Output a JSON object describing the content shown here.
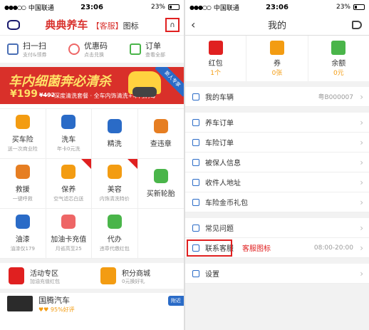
{
  "left": {
    "status": {
      "carrier": "中国联通",
      "time": "23:06",
      "battery": "23%"
    },
    "header": {
      "title": "典典养车",
      "note_bracket": "【客服】",
      "note_text": "图标"
    },
    "shortcuts": [
      {
        "label": "扫一扫",
        "sub": "支付&领券"
      },
      {
        "label": "优惠码",
        "sub": "点击兑换"
      },
      {
        "label": "订单",
        "sub": "查看全部"
      }
    ],
    "banner": {
      "slogan": "车内细菌奔必清杀",
      "price": "¥199",
      "old_price": "¥492",
      "sub": "深度清洗套餐 · 全车内饰清洗+车内消毒",
      "ribbon": "新人专享"
    },
    "grid": [
      {
        "label": "买车险",
        "sub": "送一次商业险",
        "color": "#f39c12",
        "tag": false
      },
      {
        "label": "洗车",
        "sub": "年卡0元洗",
        "color": "#2a6bc7",
        "tag": false
      },
      {
        "label": "精洗",
        "sub": "",
        "color": "#2a6bc7",
        "tag": false
      },
      {
        "label": "查违章",
        "sub": "",
        "color": "#e67e22",
        "tag": false
      },
      {
        "label": "救援",
        "sub": "一键呼救",
        "color": "#e67e22",
        "tag": false
      },
      {
        "label": "保养",
        "sub": "空气滤芯白送",
        "color": "#f39c12",
        "tag": true
      },
      {
        "label": "美容",
        "sub": "内饰清洗特价",
        "color": "#f39c12",
        "tag": true
      },
      {
        "label": "买新轮胎",
        "sub": "",
        "color": "#4ab54a",
        "tag": false
      },
      {
        "label": "油漆",
        "sub": "油漆仅179",
        "color": "#2a6bc7",
        "tag": false
      },
      {
        "label": "加油卡充值",
        "sub": "月省高至25",
        "color": "#e66",
        "tag": false
      },
      {
        "label": "代办",
        "sub": "违章代缴红包",
        "color": "#4ab54a",
        "tag": false
      },
      {
        "label": "",
        "sub": "",
        "color": "#ffffff",
        "tag": false
      }
    ],
    "promos": [
      {
        "label": "活动专区",
        "sub": "加油充值红包",
        "color": "#e02020"
      },
      {
        "label": "积分商城",
        "sub": "0元换好礼",
        "color": "#f39c12"
      }
    ],
    "shop": {
      "name": "国腾汽车",
      "rating": "95%好评",
      "near": "附近"
    }
  },
  "right": {
    "status": {
      "carrier": "中国联通",
      "time": "23:06",
      "battery": "23%"
    },
    "title": "我的",
    "stats": [
      {
        "label": "红包",
        "value": "1个",
        "color": "#e02020"
      },
      {
        "label": "券",
        "value": "0张",
        "color": "#f39c12"
      },
      {
        "label": "余额",
        "value": "0元",
        "color": "#4ab54a"
      }
    ],
    "rows": [
      {
        "label": "我的车辆",
        "value": "粤B000007"
      },
      {
        "label": "养车订单",
        "value": ""
      },
      {
        "label": "车险订单",
        "value": ""
      },
      {
        "label": "被保人信息",
        "value": ""
      },
      {
        "label": "收件人地址",
        "value": ""
      },
      {
        "label": "车险金币礼包",
        "value": ""
      },
      {
        "label": "常见问题",
        "value": ""
      },
      {
        "label": "联系客服",
        "value": "08:00-20:00",
        "annotation": "客服图标"
      },
      {
        "label": "设置",
        "value": ""
      }
    ]
  }
}
